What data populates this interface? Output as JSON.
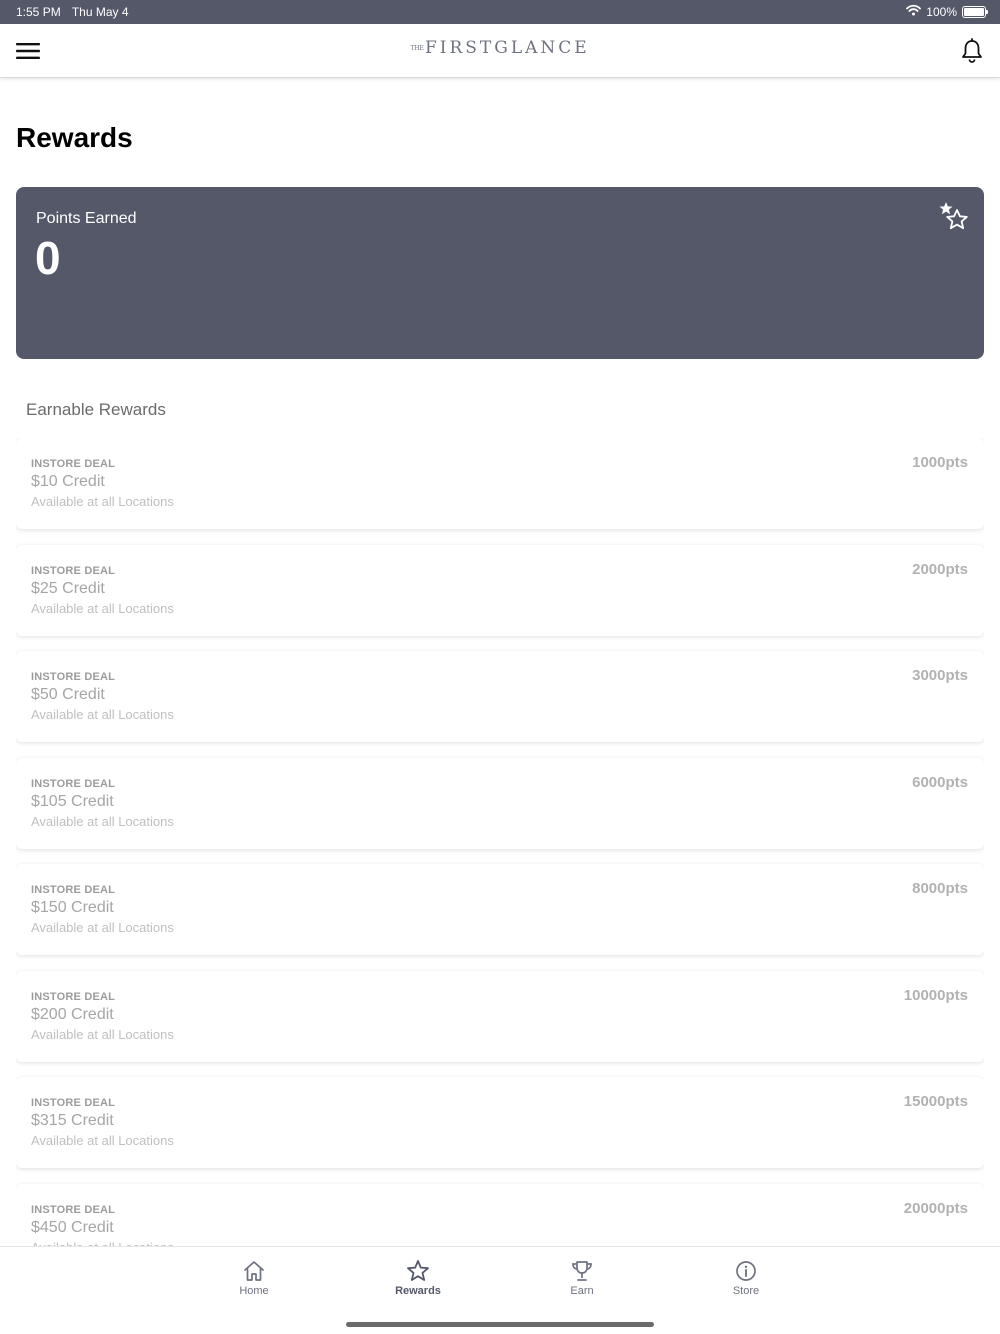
{
  "status_bar": {
    "time": "1:55 PM",
    "date": "Thu May 4",
    "battery": "100%",
    "battery_level": 1.0
  },
  "header": {
    "brand_prefix": "THE",
    "brand_name": "FIRSTGLANCE",
    "menu_icon": "hamburger-menu-icon",
    "notification_icon": "bell-icon"
  },
  "page": {
    "title": "Rewards"
  },
  "points": {
    "label": "Points Earned",
    "value": "0",
    "icon": "stars-icon"
  },
  "earnable": {
    "title": "Earnable Rewards",
    "items": [
      {
        "type": "INSTORE DEAL",
        "name": "$10 Credit",
        "location": "Available at all Locations",
        "points": "1000pts"
      },
      {
        "type": "INSTORE DEAL",
        "name": "$25 Credit",
        "location": "Available at all Locations",
        "points": "2000pts"
      },
      {
        "type": "INSTORE DEAL",
        "name": "$50 Credit",
        "location": "Available at all Locations",
        "points": "3000pts"
      },
      {
        "type": "INSTORE DEAL",
        "name": "$105 Credit",
        "location": "Available at all Locations",
        "points": "6000pts"
      },
      {
        "type": "INSTORE DEAL",
        "name": "$150 Credit",
        "location": "Available at all Locations",
        "points": "8000pts"
      },
      {
        "type": "INSTORE DEAL",
        "name": "$200 Credit",
        "location": "Available at all Locations",
        "points": "10000pts"
      },
      {
        "type": "INSTORE DEAL",
        "name": "$315 Credit",
        "location": "Available at all Locations",
        "points": "15000pts"
      },
      {
        "type": "INSTORE DEAL",
        "name": "$450 Credit",
        "location": "Available at all Locations",
        "points": "20000pts"
      }
    ]
  },
  "tabs": [
    {
      "label": "Home",
      "icon": "home-icon",
      "active": false
    },
    {
      "label": "Rewards",
      "icon": "star-icon",
      "active": true
    },
    {
      "label": "Earn",
      "icon": "trophy-icon",
      "active": false
    },
    {
      "label": "Store",
      "icon": "info-icon",
      "active": false
    }
  ],
  "colors": {
    "accent": "#545869",
    "nav_text": "#6f7280",
    "muted_text": "#a6a6a6"
  }
}
